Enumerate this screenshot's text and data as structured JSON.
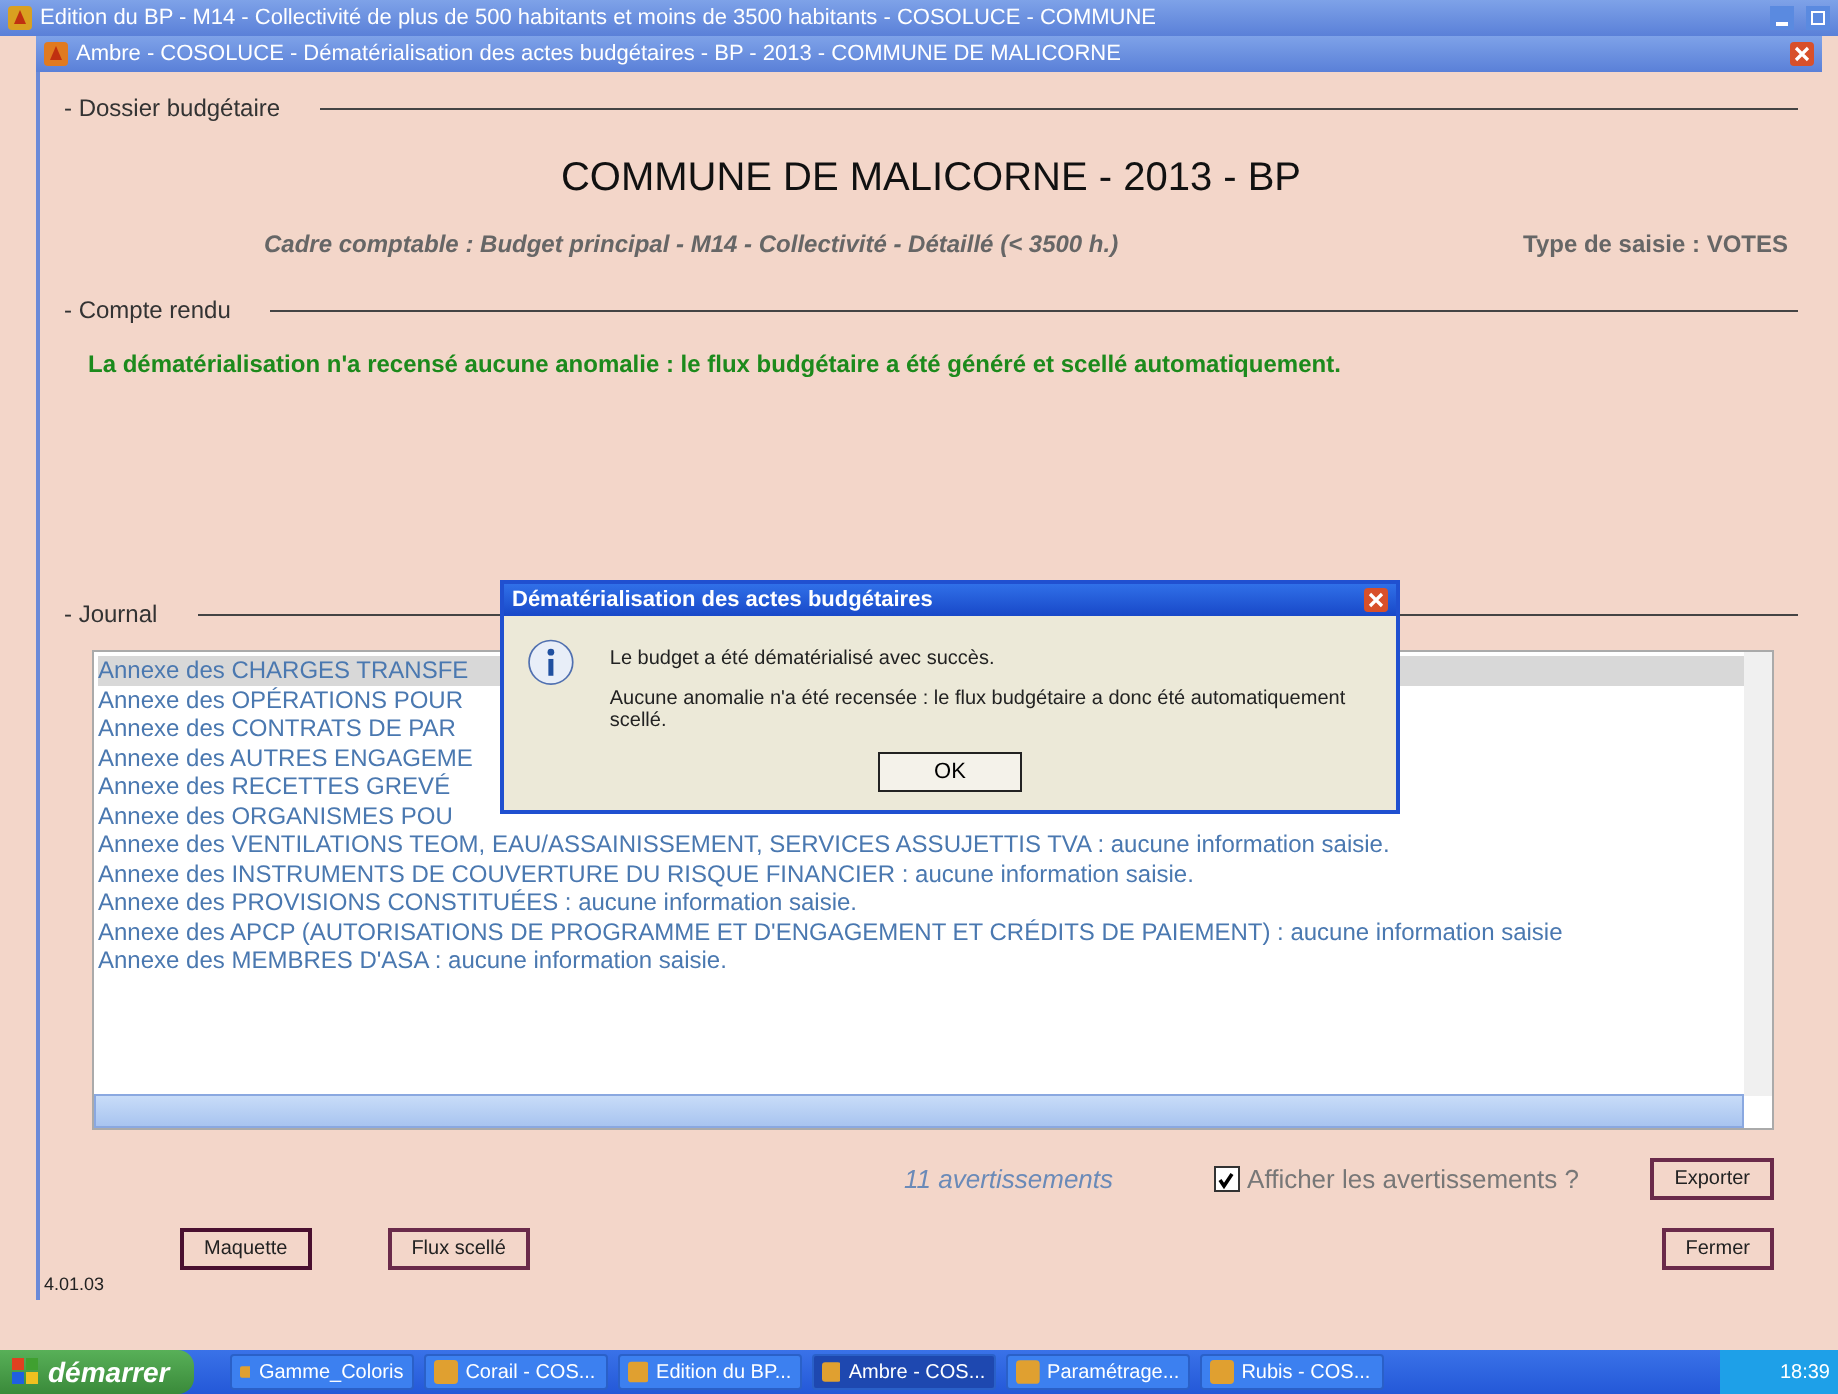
{
  "outer_window": {
    "title": "Edition du BP - M14 - Collectivité de plus de 500 habitants et moins de 3500 habitants - COSOLUCE - COMMUNE"
  },
  "window": {
    "title": "Ambre - COSOLUCE - Dématérialisation des actes budgétaires - BP - 2013 - COMMUNE DE MALICORNE"
  },
  "dossier": {
    "label": "- Dossier budgétaire",
    "heading": "COMMUNE DE MALICORNE - 2013 - BP",
    "cadre": "Cadre comptable : Budget principal - M14 - Collectivité - Détaillé (< 3500 h.)",
    "type_saisie": "Type de saisie : VOTES"
  },
  "compte_rendu": {
    "label": "- Compte rendu",
    "message": "La dématérialisation n'a recensé aucune anomalie : le flux budgétaire a été généré et scellé automatiquement."
  },
  "journal": {
    "label": "- Journal",
    "lines": [
      {
        "text": "Annexe des CHARGES TRANSFE",
        "selected": true
      },
      {
        "text": "Annexe des OPÉRATIONS POUR",
        "selected": false
      },
      {
        "text": "Annexe des CONTRATS DE PAR",
        "selected": false
      },
      {
        "text": "Annexe des AUTRES ENGAGEME",
        "selected": false
      },
      {
        "text": "Annexe des RECETTES GREVÉ",
        "selected": false
      },
      {
        "text": "Annexe des ORGANISMES POU",
        "selected": false
      },
      {
        "text": "Annexe des VENTILATIONS TEOM, EAU/ASSAINISSEMENT, SERVICES ASSUJETTIS TVA : aucune information saisie.",
        "selected": false
      },
      {
        "text": "Annexe des INSTRUMENTS DE COUVERTURE DU RISQUE FINANCIER : aucune information saisie.",
        "selected": false
      },
      {
        "text": "Annexe des PROVISIONS CONSTITUÉES : aucune information saisie.",
        "selected": false
      },
      {
        "text": "Annexe des APCP (AUTORISATIONS DE PROGRAMME ET D'ENGAGEMENT ET CRÉDITS DE PAIEMENT) : aucune information saisie",
        "selected": false
      },
      {
        "text": "Annexe des MEMBRES D'ASA : aucune information saisie.",
        "selected": false
      }
    ],
    "count": "11 avertissements",
    "show_warnings": {
      "label": "Afficher les avertissements ?",
      "checked": true
    }
  },
  "buttons": {
    "export": "Exporter",
    "maquette": "Maquette",
    "flux": "Flux scellé",
    "close": "Fermer"
  },
  "version": "4.01.03",
  "dialog": {
    "title": "Dématérialisation des actes budgétaires",
    "line_1": "Le budget a été dématérialisé avec succès.",
    "line_2": "Aucune anomalie n'a été recensée : le flux budgétaire a donc été automatiquement scellé.",
    "ok": "OK"
  },
  "taskbar": {
    "start": "démarrer",
    "items": [
      {
        "label": "Gamme_Coloris",
        "selected": false
      },
      {
        "label": "Corail - COS...",
        "selected": false
      },
      {
        "label": "Edition du BP...",
        "selected": false
      },
      {
        "label": "Ambre - COS...",
        "selected": true
      },
      {
        "label": "Paramétrage...",
        "selected": false
      },
      {
        "label": "Rubis - COS...",
        "selected": false
      }
    ],
    "clock": "18:39"
  }
}
